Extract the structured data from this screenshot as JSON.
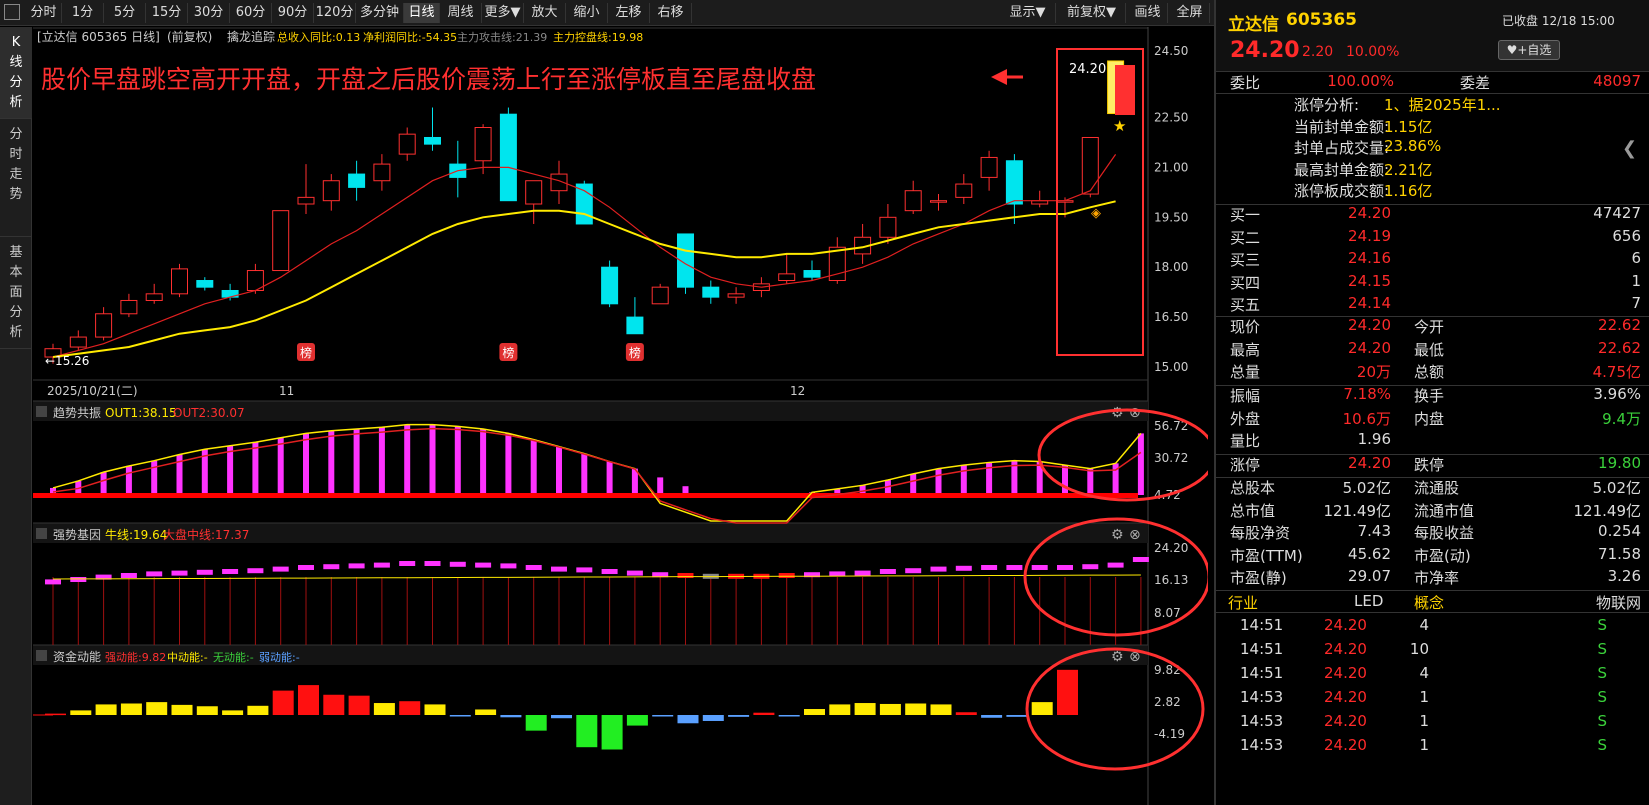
{
  "toolbar": {
    "items": [
      "分时",
      "1分",
      "5分",
      "15分",
      "30分",
      "60分",
      "90分",
      "120分",
      "多分钟",
      "日线",
      "周线",
      "更多▼",
      "放大",
      "缩小",
      "左移",
      "右移"
    ],
    "active": "日线",
    "right_items": [
      "显示▼",
      "前复权▼",
      "画线",
      "全屏"
    ]
  },
  "leftnav": [
    "K线分析",
    "分时走势",
    "基本面分析"
  ],
  "info_bar": {
    "title": "[立达信 605365 日线]",
    "adj": "(前复权)",
    "indicator": "擒龙追踪",
    "rev_label": "总收入同比:0.13",
    "profit_label": "净利润同比:-54.35",
    "attack_label": "主力攻击线:21.39",
    "control_label": "主力控盘线:19.98"
  },
  "annotation": "股价早盘跳空高开开盘，开盘之后股价震荡上行至涨停板直至尾盘收盘",
  "price_axis": [
    "24.50",
    "22.50",
    "21.00",
    "19.50",
    "18.00",
    "16.50",
    "15.00"
  ],
  "date_axis": {
    "start": "2025/10/21(二)",
    "m1": "11",
    "m2": "12"
  },
  "low_label": "15.26",
  "high_label": "24.20",
  "bang_label": "榜",
  "panel1": {
    "name": "趋势共振",
    "out1": "OUT1:38.15",
    "out2": "OUT2:30.07",
    "axis": [
      "56.72",
      "30.72",
      "4.72"
    ]
  },
  "panel2": {
    "name": "强势基因",
    "niu": "牛线:19.64",
    "dapan": "大盘中线:17.37",
    "axis": [
      "24.20",
      "16.13",
      "8.07"
    ]
  },
  "panel3": {
    "name": "资金动能",
    "strong": "强动能:9.82",
    "mid": "中动能:-",
    "none": "无动能:-",
    "weak": "弱动能:-",
    "axis": [
      "9.82",
      "2.82",
      "-4.19"
    ]
  },
  "chart_data": {
    "type": "candlestick",
    "candles": [
      {
        "o": 15.3,
        "c": 15.55,
        "h": 15.7,
        "l": 15.1
      },
      {
        "o": 15.6,
        "c": 15.9,
        "h": 16.1,
        "l": 15.5
      },
      {
        "o": 15.9,
        "c": 16.6,
        "h": 16.8,
        "l": 15.8
      },
      {
        "o": 16.6,
        "c": 17.0,
        "h": 17.2,
        "l": 16.5
      },
      {
        "o": 17.0,
        "c": 17.2,
        "h": 17.5,
        "l": 16.9
      },
      {
        "o": 17.2,
        "c": 17.95,
        "h": 18.1,
        "l": 17.1
      },
      {
        "o": 17.6,
        "c": 17.4,
        "h": 17.7,
        "l": 17.3
      },
      {
        "o": 17.3,
        "c": 17.1,
        "h": 17.5,
        "l": 17.0
      },
      {
        "o": 17.3,
        "c": 17.9,
        "h": 18.1,
        "l": 17.2
      },
      {
        "o": 17.9,
        "c": 19.7,
        "h": 19.7,
        "l": 17.9
      },
      {
        "o": 19.9,
        "c": 20.1,
        "h": 21.1,
        "l": 19.6
      },
      {
        "o": 20.0,
        "c": 20.6,
        "h": 20.8,
        "l": 19.7
      },
      {
        "o": 20.8,
        "c": 20.4,
        "h": 21.2,
        "l": 20.0
      },
      {
        "o": 20.6,
        "c": 21.1,
        "h": 21.4,
        "l": 20.3
      },
      {
        "o": 21.4,
        "c": 22.0,
        "h": 22.2,
        "l": 21.2
      },
      {
        "o": 21.9,
        "c": 21.7,
        "h": 22.8,
        "l": 21.5
      },
      {
        "o": 21.1,
        "c": 20.7,
        "h": 21.8,
        "l": 20.1
      },
      {
        "o": 21.2,
        "c": 22.2,
        "h": 22.3,
        "l": 20.8
      },
      {
        "o": 22.6,
        "c": 20.0,
        "h": 22.8,
        "l": 20.0
      },
      {
        "o": 19.9,
        "c": 20.6,
        "h": 20.6,
        "l": 19.3
      },
      {
        "o": 20.3,
        "c": 20.8,
        "h": 21.2,
        "l": 19.9
      },
      {
        "o": 20.5,
        "c": 19.3,
        "h": 20.6,
        "l": 19.3
      },
      {
        "o": 18.0,
        "c": 16.9,
        "h": 18.2,
        "l": 16.8
      },
      {
        "o": 16.5,
        "c": 16.0,
        "h": 17.1,
        "l": 16.0
      },
      {
        "o": 16.9,
        "c": 17.4,
        "h": 17.5,
        "l": 16.9
      },
      {
        "o": 19.0,
        "c": 17.4,
        "h": 19.0,
        "l": 17.2
      },
      {
        "o": 17.4,
        "c": 17.1,
        "h": 17.6,
        "l": 16.9
      },
      {
        "o": 17.1,
        "c": 17.2,
        "h": 17.4,
        "l": 16.9
      },
      {
        "o": 17.3,
        "c": 17.5,
        "h": 17.7,
        "l": 17.1
      },
      {
        "o": 17.6,
        "c": 17.8,
        "h": 18.4,
        "l": 17.5
      },
      {
        "o": 17.9,
        "c": 17.7,
        "h": 18.2,
        "l": 17.6
      },
      {
        "o": 17.6,
        "c": 18.6,
        "h": 18.9,
        "l": 17.5
      },
      {
        "o": 18.4,
        "c": 18.9,
        "h": 19.3,
        "l": 18.1
      },
      {
        "o": 18.9,
        "c": 19.5,
        "h": 19.9,
        "l": 18.7
      },
      {
        "o": 19.7,
        "c": 20.3,
        "h": 20.6,
        "l": 19.6
      },
      {
        "o": 20.0,
        "c": 20.0,
        "h": 20.2,
        "l": 19.7
      },
      {
        "o": 20.1,
        "c": 20.5,
        "h": 20.8,
        "l": 19.9
      },
      {
        "o": 20.7,
        "c": 21.3,
        "h": 21.5,
        "l": 20.3
      },
      {
        "o": 21.2,
        "c": 19.9,
        "h": 21.4,
        "l": 19.3
      },
      {
        "o": 19.9,
        "c": 20.0,
        "h": 20.3,
        "l": 19.8
      },
      {
        "o": 20.0,
        "c": 20.0,
        "h": 20.1,
        "l": 19.5
      },
      {
        "o": 20.2,
        "c": 21.9,
        "h": 21.9,
        "l": 20.1
      },
      {
        "o": 22.62,
        "c": 24.2,
        "h": 24.2,
        "l": 22.62
      }
    ],
    "ma_red": [
      15.3,
      15.5,
      15.7,
      16.0,
      16.3,
      16.6,
      16.9,
      17.1,
      17.3,
      17.7,
      18.2,
      18.7,
      19.1,
      19.6,
      20.1,
      20.6,
      20.9,
      21.0,
      21.0,
      20.8,
      20.6,
      20.3,
      19.8,
      19.2,
      18.6,
      18.1,
      17.7,
      17.5,
      17.4,
      17.5,
      17.6,
      17.8,
      18.0,
      18.3,
      18.7,
      19.0,
      19.3,
      19.7,
      20.0,
      20.0,
      20.0,
      20.3,
      21.39
    ],
    "ma_yellow": [
      15.3,
      15.4,
      15.5,
      15.6,
      15.8,
      16.0,
      16.1,
      16.2,
      16.4,
      16.7,
      17.0,
      17.4,
      17.8,
      18.2,
      18.6,
      19.0,
      19.3,
      19.5,
      19.6,
      19.7,
      19.7,
      19.6,
      19.3,
      19.0,
      18.7,
      18.5,
      18.4,
      18.3,
      18.3,
      18.4,
      18.4,
      18.5,
      18.6,
      18.8,
      19.0,
      19.2,
      19.3,
      19.4,
      19.5,
      19.6,
      19.6,
      19.8,
      19.98
    ],
    "vol1": [
      0.8,
      1.6,
      2.6,
      3.3,
      3.9,
      4.6,
      5.2,
      5.6,
      6.0,
      6.5,
      7.0,
      7.3,
      7.5,
      7.7,
      8.0,
      8.0,
      7.8,
      7.5,
      7.0,
      6.3,
      5.5,
      4.7,
      3.8,
      3.0,
      2.0,
      1.0,
      0,
      0,
      0,
      0,
      0.3,
      0.7,
      1.1,
      1.7,
      2.4,
      3.0,
      3.4,
      3.7,
      3.9,
      3.8,
      3.4,
      3.0,
      3.6,
      7.0
    ],
    "vol2": [
      3.2,
      3.5,
      3.8,
      4.0,
      4.2,
      4.3,
      4.4,
      4.5,
      4.6,
      4.8,
      5.0,
      5.1,
      5.2,
      5.3,
      5.5,
      5.5,
      5.4,
      5.3,
      5.2,
      5.0,
      4.8,
      4.7,
      4.5,
      4.3,
      4.1,
      4.0,
      3.9,
      3.9,
      3.9,
      4.0,
      4.1,
      4.2,
      4.3,
      4.5,
      4.6,
      4.8,
      4.9,
      5.0,
      5.0,
      5.0,
      5.0,
      5.1,
      5.3,
      6.0
    ],
    "vol3": [
      0.3,
      1.0,
      2.3,
      2.5,
      2.8,
      2.2,
      1.9,
      1.0,
      2.0,
      5.3,
      6.5,
      4.4,
      4.2,
      2.6,
      3.0,
      2.3,
      -0.2,
      1.2,
      -0.5,
      -3.4,
      -0.7,
      -7.0,
      -7.5,
      -2.3,
      -0.2,
      -1.8,
      -1.3,
      -0.4,
      0.5,
      -0.2,
      1.3,
      2.3,
      2.6,
      2.4,
      2.5,
      2.3,
      0.6,
      -0.6,
      -0.4,
      2.8,
      9.82
    ]
  },
  "right": {
    "stock_name": "立达信",
    "code": "605365",
    "closed": "已收盘 12/18 15:00",
    "price": "24.20",
    "change": "2.20",
    "pct": "10.00%",
    "watch_btn": "+自选",
    "weibi_label": "委比",
    "weibi_val": "100.00%",
    "weicha_label": "委差",
    "weicha_val": "48097",
    "limit_info": [
      {
        "k": "涨停分析:",
        "v": "1、据2025年1..."
      },
      {
        "k": "当前封单金额:",
        "v": "1.15亿"
      },
      {
        "k": "封单占成交量:",
        "v": "23.86%"
      },
      {
        "k": "最高封单金额:",
        "v": "2.21亿"
      },
      {
        "k": "涨停板成交额:",
        "v": "1.16亿"
      }
    ],
    "bids": [
      {
        "k": "买一",
        "p": "24.20",
        "v": "47427"
      },
      {
        "k": "买二",
        "p": "24.19",
        "v": "656"
      },
      {
        "k": "买三",
        "p": "24.16",
        "v": "6"
      },
      {
        "k": "买四",
        "p": "24.15",
        "v": "1"
      },
      {
        "k": "买五",
        "p": "24.14",
        "v": "7"
      }
    ],
    "stats1": [
      {
        "k": "现价",
        "v": "24.20",
        "k2": "今开",
        "v2": "22.62"
      },
      {
        "k": "最高",
        "v": "24.20",
        "k2": "最低",
        "v2": "22.62"
      },
      {
        "k": "总量",
        "v": "20万",
        "k2": "总额",
        "v2": "4.75亿"
      }
    ],
    "stats2": [
      {
        "k": "振幅",
        "v": "7.18%",
        "k2": "换手",
        "v2": "3.96%"
      },
      {
        "k": "外盘",
        "v": "10.6万",
        "k2": "内盘",
        "v2": "9.4万"
      },
      {
        "k": "量比",
        "v": "1.96",
        "k2": "",
        "v2": ""
      }
    ],
    "stats3": [
      {
        "k": "涨停",
        "v": "24.20",
        "k2": "跌停",
        "v2": "19.80"
      }
    ],
    "stats4": [
      {
        "k": "总股本",
        "v": "5.02亿",
        "k2": "流通股",
        "v2": "5.02亿"
      },
      {
        "k": "总市值",
        "v": "121.49亿",
        "k2": "流通市值",
        "v2": "121.49亿"
      },
      {
        "k": "每股净资",
        "v": "7.43",
        "k2": "每股收益",
        "v2": "0.254"
      },
      {
        "k": "市盈(TTM)",
        "v": "45.62",
        "k2": "市盈(动)",
        "v2": "71.58"
      },
      {
        "k": "市盈(静)",
        "v": "29.07",
        "k2": "市净率",
        "v2": "3.26"
      }
    ],
    "industry_label": "行业",
    "industry": "LED",
    "concept_label": "概念",
    "concept": "物联网",
    "ticks": [
      {
        "t": "14:51",
        "p": "24.20",
        "v": "4",
        "s": "S"
      },
      {
        "t": "14:51",
        "p": "24.20",
        "v": "10",
        "s": "S"
      },
      {
        "t": "14:51",
        "p": "24.20",
        "v": "4",
        "s": "S"
      },
      {
        "t": "14:53",
        "p": "24.20",
        "v": "1",
        "s": "S"
      },
      {
        "t": "14:53",
        "p": "24.20",
        "v": "1",
        "s": "S"
      },
      {
        "t": "14:53",
        "p": "24.20",
        "v": "1",
        "s": "S"
      }
    ]
  }
}
